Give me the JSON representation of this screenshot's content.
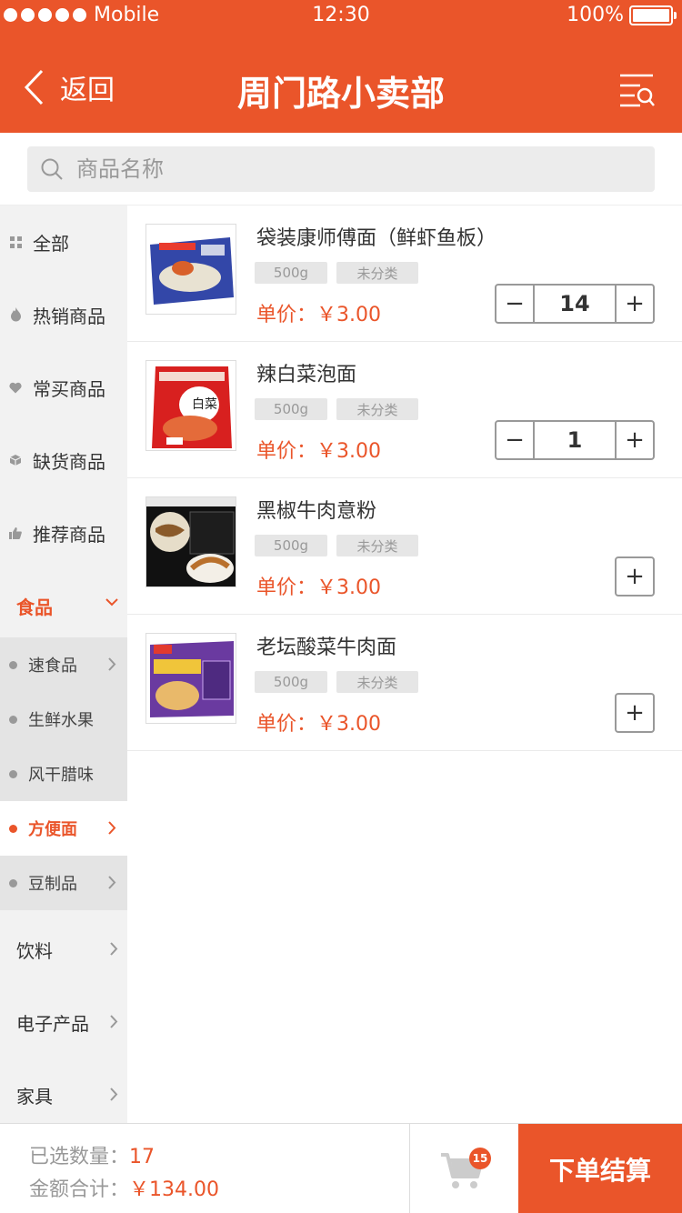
{
  "status_bar": {
    "carrier": "Mobile",
    "time": "12:30",
    "battery": "100%"
  },
  "header": {
    "back_label": "返回",
    "title": "周门路小卖部"
  },
  "search": {
    "placeholder": "商品名称"
  },
  "sidebar": {
    "items": [
      {
        "label": "全部",
        "icon": "grid-icon"
      },
      {
        "label": "热销商品",
        "icon": "flame-icon"
      },
      {
        "label": "常买商品",
        "icon": "heart-icon"
      },
      {
        "label": "缺货商品",
        "icon": "box-icon"
      },
      {
        "label": "推荐商品",
        "icon": "thumbs-up-icon"
      }
    ],
    "food_category": "食品",
    "subcategories": [
      {
        "label": "速食品",
        "has_chevron": true
      },
      {
        "label": "生鲜水果",
        "has_chevron": false
      },
      {
        "label": "风干腊味",
        "has_chevron": false
      },
      {
        "label": "方便面",
        "has_chevron": true,
        "active": true
      },
      {
        "label": "豆制品",
        "has_chevron": true
      }
    ],
    "categories": [
      {
        "label": "饮料"
      },
      {
        "label": "电子产品"
      },
      {
        "label": "家具"
      }
    ]
  },
  "products": [
    {
      "name": "袋装康师傅面（鲜虾鱼板）",
      "weight": "500g",
      "category": "未分类",
      "price": "单价：￥3.00",
      "quantity": "14"
    },
    {
      "name": "辣白菜泡面",
      "weight": "500g",
      "category": "未分类",
      "price": "单价：￥3.00",
      "quantity": "1"
    },
    {
      "name": "黑椒牛肉意粉",
      "weight": "500g",
      "category": "未分类",
      "price": "单价：￥3.00",
      "quantity": null
    },
    {
      "name": "老坛酸菜牛肉面",
      "weight": "500g",
      "category": "未分类",
      "price": "单价：￥3.00",
      "quantity": null
    }
  ],
  "footer": {
    "selected_label": "已选数量：",
    "selected_value": "17",
    "total_label": "金额合计：",
    "total_value": "￥134.00",
    "cart_badge": "15",
    "checkout_label": "下单结算"
  },
  "colors": {
    "accent": "#ea552a",
    "sidebar_bg": "#f2f2f2",
    "sub_bg": "#e4e4e4"
  }
}
